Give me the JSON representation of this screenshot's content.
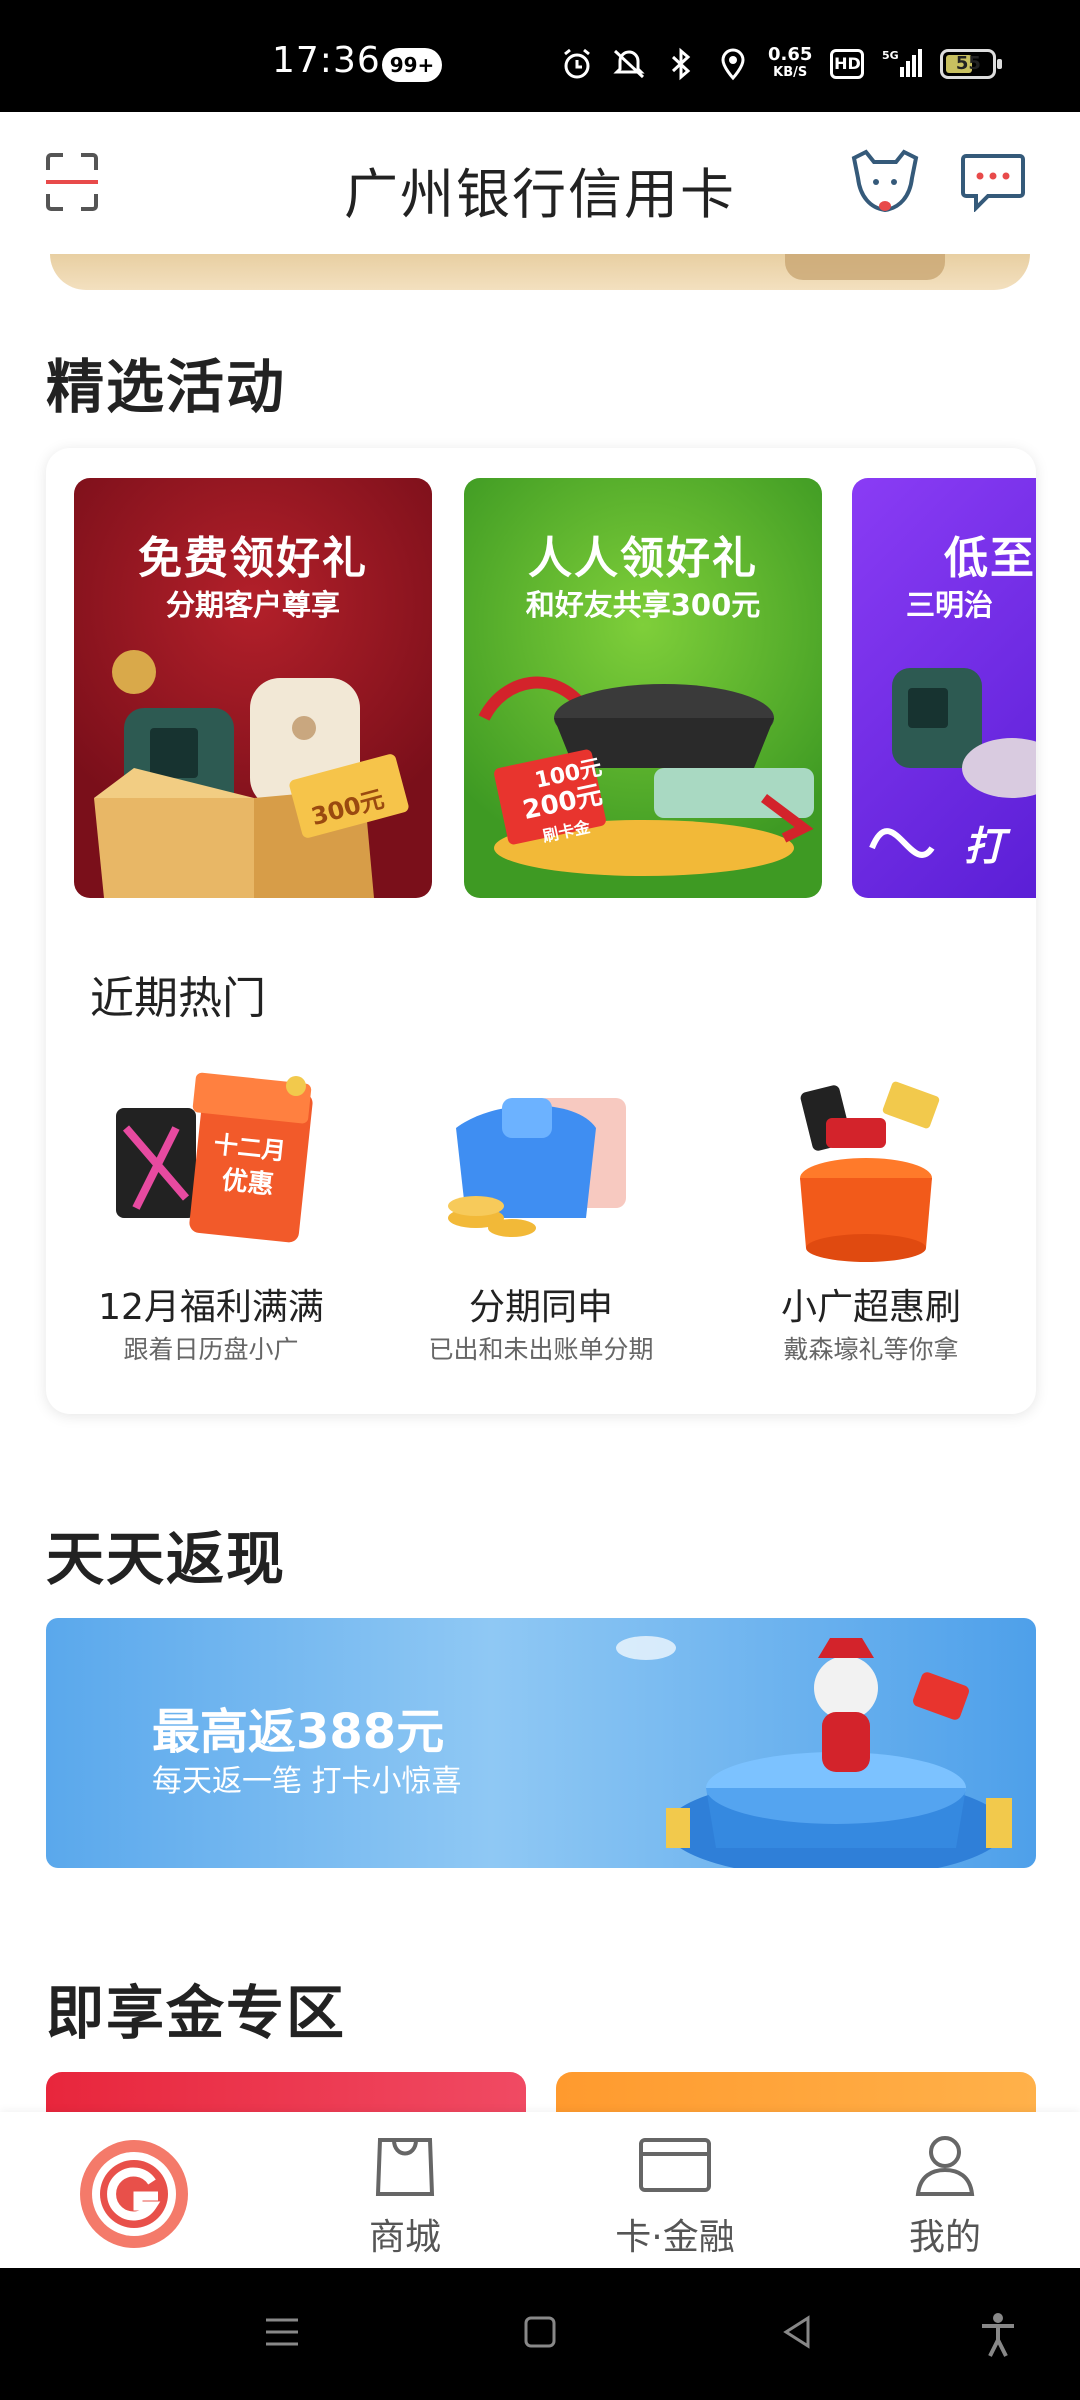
{
  "status_bar": {
    "time": "17:36",
    "notification_badge": "99+",
    "net_speed_value": "0.65",
    "net_speed_unit": "KB/S",
    "hd": "HD",
    "network": "5G",
    "battery": "55"
  },
  "header": {
    "title": "广州银行信用卡",
    "icons": [
      "scan-icon",
      "mascot-icon",
      "message-icon"
    ]
  },
  "featured": {
    "title": "精选活动",
    "promos": [
      {
        "title": "免费领好礼",
        "subtitle": "分期客户尊享",
        "badge": "300元"
      },
      {
        "title": "人人领好礼",
        "subtitle": "和好友共享300元",
        "badge_top": "100元",
        "badge_mid": "200元",
        "badge_bot": "刷卡金"
      },
      {
        "title": "低至",
        "subtitle": "三明治",
        "corner": "打"
      }
    ],
    "hot_title": "近期热门",
    "hot_items": [
      {
        "name": "12月福利满满",
        "desc": "跟着日历盘小广",
        "calendar_top": "十二月",
        "calendar_bot": "优惠"
      },
      {
        "name": "分期同申",
        "desc": "已出和未出账单分期"
      },
      {
        "name": "小广超惠刷",
        "desc": "戴森壕礼等你拿"
      }
    ]
  },
  "cashback": {
    "title": "天天返现",
    "banner_title": "最高返388元",
    "banner_sub": "每天返一笔 打卡小惊喜"
  },
  "instant": {
    "title": "即享金专区"
  },
  "bottom_nav": {
    "items": [
      {
        "label": "",
        "icon": "home-logo-icon"
      },
      {
        "label": "商城",
        "icon": "shopping-bag-icon"
      },
      {
        "label": "卡·金融",
        "icon": "card-icon"
      },
      {
        "label": "我的",
        "icon": "user-icon"
      }
    ]
  },
  "colors": {
    "accent_red": "#e8263c",
    "brand_red": "#e84a4a"
  }
}
